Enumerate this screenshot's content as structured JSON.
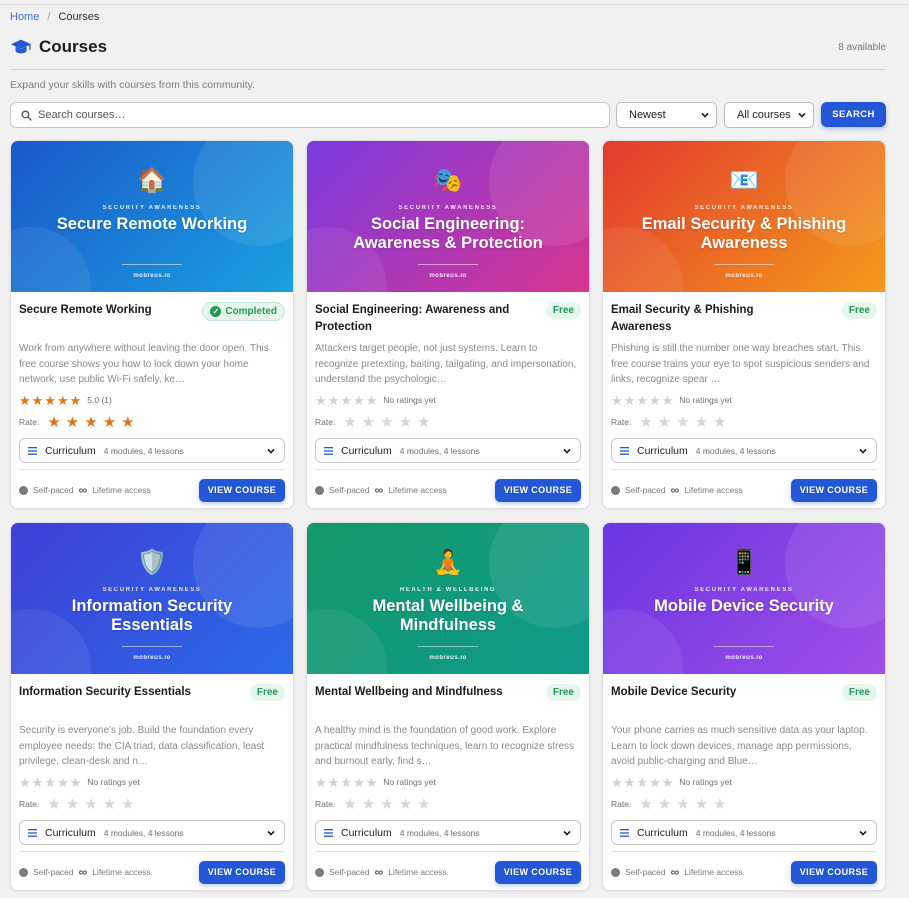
{
  "breadcrumb": {
    "home": "Home",
    "separator": "/",
    "current": "Courses"
  },
  "header": {
    "title": "Courses",
    "available": "8 available",
    "icon": "graduation-cap-icon"
  },
  "subtitle": "Expand your skills with courses from this community.",
  "search": {
    "placeholder": "Search courses…",
    "value": ""
  },
  "sort": {
    "selected": "Newest"
  },
  "filter": {
    "selected": "All courses"
  },
  "search_button": "SEARCH",
  "labels": {
    "rate": "Rate:",
    "curriculum": "Curriculum",
    "self_paced": "Self-paced",
    "lifetime": "Lifetime access",
    "view": "VIEW COURSE",
    "brand": "mobreus.io"
  },
  "colors": {
    "accent": "#2457d6",
    "success": "#1f9a50",
    "star": "#d9781c"
  },
  "courses": [
    {
      "name": "Secure Remote Working",
      "banner_title": "Secure Remote Working",
      "category": "SECURITY AWARENESS",
      "emoji": "🏠",
      "gradient": [
        "#1a58c9",
        "#1aa0e0"
      ],
      "badge": "Completed",
      "badge_type": "completed",
      "description": "Work from anywhere without leaving the door open. This free course shows you how to lock down your home network, use public Wi-Fi safely, ke…",
      "rating": 5,
      "rating_text": "5.0 (1)",
      "user_rating": 5,
      "curriculum_meta": "4 modules, 4 lessons"
    },
    {
      "name": "Social Engineering: Awareness and Protection",
      "banner_title": "Social Engineering: Awareness & Protection",
      "category": "SECURITY AWARENESS",
      "emoji": "🎭",
      "gradient": [
        "#7b3be0",
        "#d8348f"
      ],
      "badge": "Free",
      "badge_type": "free",
      "description": "Attackers target people, not just systems. Learn to recognize pretexting, baiting, tailgating, and impersonation, understand the psychologic…",
      "rating": 0,
      "rating_text": "No ratings yet",
      "user_rating": 0,
      "curriculum_meta": "4 modules, 4 lessons"
    },
    {
      "name": "Email Security & Phishing Awareness",
      "banner_title": "Email Security & Phishing Awareness",
      "category": "SECURITY AWARENESS",
      "emoji": "📧",
      "gradient": [
        "#e23a2e",
        "#f39a1a"
      ],
      "badge": "Free",
      "badge_type": "free",
      "description": "Phishing is still the number one way breaches start. This free course trains your eye to spot suspicious senders and links, recognize spear …",
      "rating": 0,
      "rating_text": "No ratings yet",
      "user_rating": 0,
      "curriculum_meta": "4 modules, 4 lessons"
    },
    {
      "name": "Information Security Essentials",
      "banner_title": "Information Security Essentials",
      "category": "SECURITY AWARENESS",
      "emoji": "🛡️",
      "gradient": [
        "#3f3fd6",
        "#2a6ae8"
      ],
      "badge": "Free",
      "badge_type": "free",
      "description": "Security is everyone's job. Build the foundation every employee needs: the CIA triad, data classification, least privilege, clean-desk and n…",
      "rating": 0,
      "rating_text": "No ratings yet",
      "user_rating": 0,
      "curriculum_meta": "4 modules, 4 lessons"
    },
    {
      "name": "Mental Wellbeing and Mindfulness",
      "banner_title": "Mental Wellbeing & Mindfulness",
      "category": "HEALTH & WELLBEING",
      "emoji": "🧘",
      "gradient": [
        "#14986a",
        "#0e9a8a"
      ],
      "badge": "Free",
      "badge_type": "free",
      "description": "A healthy mind is the foundation of good work. Explore practical mindfulness techniques, learn to recognize stress and burnout early, find s…",
      "rating": 0,
      "rating_text": "No ratings yet",
      "user_rating": 0,
      "curriculum_meta": "4 modules, 4 lessons"
    },
    {
      "name": "Mobile Device Security",
      "banner_title": "Mobile Device Security",
      "category": "SECURITY AWARENESS",
      "emoji": "📱",
      "gradient": [
        "#6a35e0",
        "#a04ee8"
      ],
      "badge": "Free",
      "badge_type": "free",
      "description": "Your phone carries as much sensitive data as your laptop. Learn to lock down devices, manage app permissions, avoid public-charging and Blue…",
      "rating": 0,
      "rating_text": "No ratings yet",
      "user_rating": 0,
      "curriculum_meta": "4 modules, 4 lessons"
    }
  ]
}
